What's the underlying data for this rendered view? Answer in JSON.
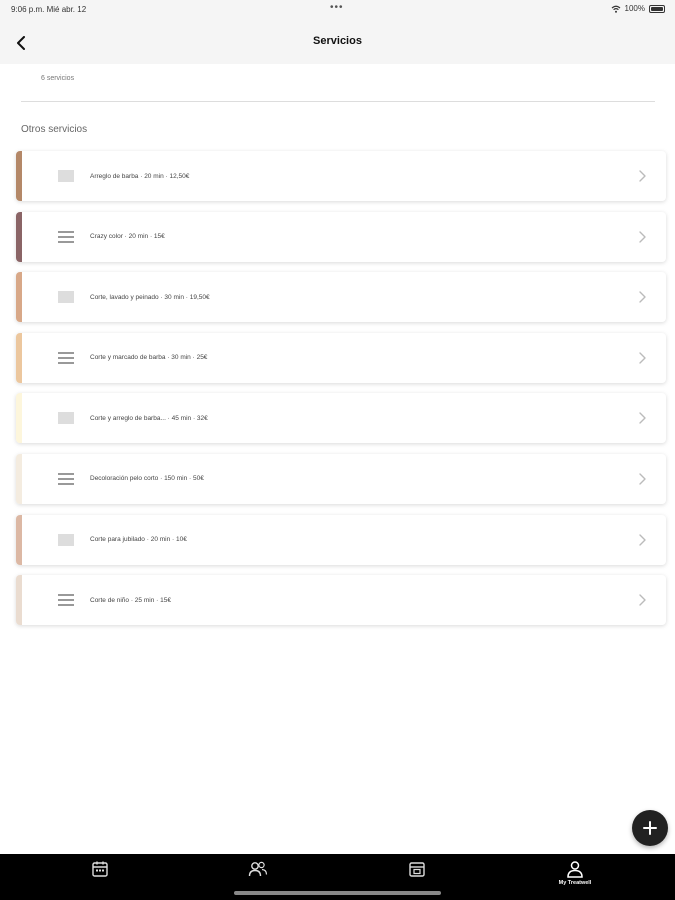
{
  "status_bar": {
    "time": "9:06 p.m.  Mié abr. 12",
    "dots": "•••",
    "battery": "100%"
  },
  "nav": {
    "title": "Servicios",
    "back_icon": "chevron-left-icon"
  },
  "top_card": {
    "text": "6 servicios"
  },
  "section_title": "Otros servicios",
  "services": [
    {
      "label": "Arreglo de barba · 20 min · 12,50€",
      "color": "#b48868",
      "icon": "box"
    },
    {
      "label": "Crazy color · 20 min · 15€",
      "color": "#8a6466",
      "icon": "lines"
    },
    {
      "label": "Corte, lavado y peinado · 30 min · 19,50€",
      "color": "#d8a888",
      "icon": "box"
    },
    {
      "label": "Corte y marcado de barba · 30 min · 25€",
      "color": "#ecc79e",
      "icon": "lines"
    },
    {
      "label": "Corte y arreglo de barba... · 45 min · 32€",
      "color": "#fdf6dc",
      "icon": "box"
    },
    {
      "label": "Decoloración pelo corto · 150 min · 50€",
      "color": "#f4ece0",
      "icon": "lines"
    },
    {
      "label": "Corte para jubilado · 20 min · 10€",
      "color": "#dcb8a4",
      "icon": "box"
    },
    {
      "label": "Corte de niño · 25 min · 15€",
      "color": "#eadcd0",
      "icon": "lines"
    }
  ],
  "fab": {
    "icon": "plus-icon"
  },
  "tab_bar": {
    "tabs": [
      {
        "icon": "calendar-icon",
        "label": ""
      },
      {
        "icon": "users-icon",
        "label": ""
      },
      {
        "icon": "store-icon",
        "label": ""
      },
      {
        "icon": "profile-icon",
        "label": "My Treatwell"
      }
    ]
  },
  "colors": {
    "tab_bar": "#000000",
    "fab": "#222222",
    "nav_bg": "#f5f5f5"
  }
}
